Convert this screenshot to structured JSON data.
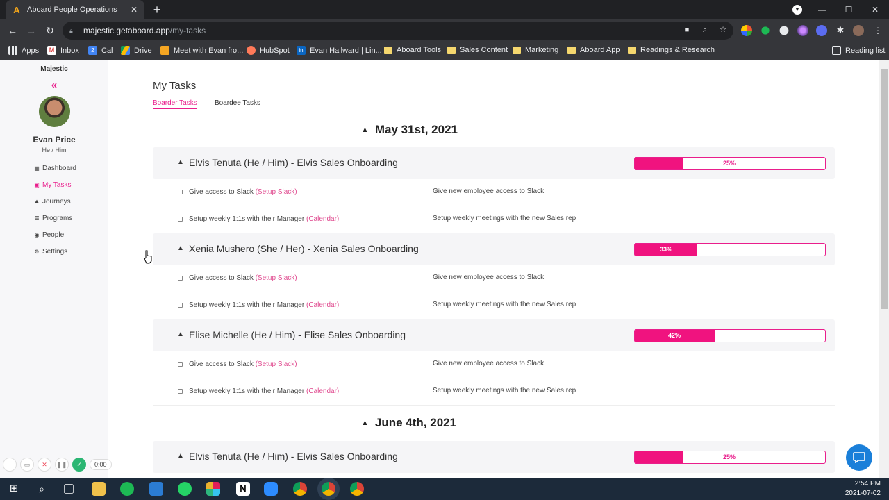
{
  "browser": {
    "tab_title": "Aboard People Operations",
    "url_host": "majestic.getaboard.app",
    "url_path": "/my-tasks",
    "bookmarks": [
      "Apps",
      "Inbox",
      "Cal",
      "Drive",
      "Meet with Evan fro...",
      "HubSpot",
      "Evan Hallward | Lin...",
      "Aboard Tools",
      "Sales Content",
      "Marketing",
      "Aboard App",
      "Readings & Research"
    ],
    "reading_list": "Reading list"
  },
  "sidebar": {
    "brand": "Majestic",
    "user_name": "Evan Price",
    "user_pronouns": "He / Him",
    "items": [
      {
        "label": "Dashboard",
        "icon": "dashboard-icon"
      },
      {
        "label": "My Tasks",
        "icon": "tasks-icon"
      },
      {
        "label": "Journeys",
        "icon": "journeys-icon"
      },
      {
        "label": "Programs",
        "icon": "programs-icon"
      },
      {
        "label": "People",
        "icon": "people-icon"
      },
      {
        "label": "Settings",
        "icon": "settings-icon"
      }
    ]
  },
  "main": {
    "title": "My Tasks",
    "tabs": [
      "Boarder Tasks",
      "Boardee Tasks"
    ],
    "sections": [
      {
        "date": "May 31st, 2021",
        "groups": [
          {
            "title": "Elvis Tenuta (He / Him) - Elvis Sales Onboarding",
            "progress": "25%",
            "tasks": [
              {
                "name": "Give access to Slack",
                "link": "(Setup Slack)",
                "desc": "Give new employee access to Slack"
              },
              {
                "name": "Setup weekly 1:1s with their Manager",
                "link": "(Calendar)",
                "desc": "Setup weekly meetings with the new Sales rep"
              }
            ]
          },
          {
            "title": "Xenia Mushero (She / Her) - Xenia Sales Onboarding",
            "progress": "33%",
            "tasks": [
              {
                "name": "Give access to Slack",
                "link": "(Setup Slack)",
                "desc": "Give new employee access to Slack"
              },
              {
                "name": "Setup weekly 1:1s with their Manager",
                "link": "(Calendar)",
                "desc": "Setup weekly meetings with the new Sales rep"
              }
            ]
          },
          {
            "title": "Elise Michelle (He / Him) - Elise Sales Onboarding",
            "progress": "42%",
            "tasks": [
              {
                "name": "Give access to Slack",
                "link": "(Setup Slack)",
                "desc": "Give new employee access to Slack"
              },
              {
                "name": "Setup weekly 1:1s with their Manager",
                "link": "(Calendar)",
                "desc": "Setup weekly meetings with the new Sales rep"
              }
            ]
          }
        ]
      },
      {
        "date": "June 4th, 2021",
        "groups": [
          {
            "title": "Elvis Tenuta (He / Him) - Elvis Sales Onboarding",
            "progress": "25%",
            "tasks": []
          }
        ]
      }
    ]
  },
  "recorder": {
    "time": "0:00"
  },
  "taskbar": {
    "time": "2:54 PM",
    "date": "2021-07-02"
  },
  "colors": {
    "accent": "#e91e8c",
    "progress_fill": "#f0137f"
  }
}
